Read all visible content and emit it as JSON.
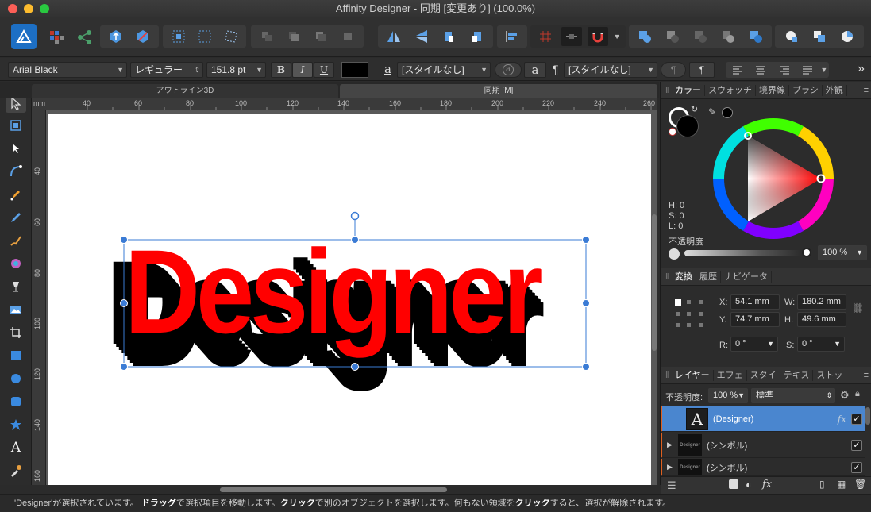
{
  "window": {
    "title": "Affinity Designer - 同期 [変更あり] (100.0%)"
  },
  "context_bar": {
    "font_family": "Arial Black",
    "font_style": "レギュラー",
    "font_size": "151.8 pt",
    "bold_label": "B",
    "italic_label": "I",
    "underline_label": "U",
    "char_style_glyph": "a",
    "char_style": "[スタイルなし]",
    "char_glyph2": "a",
    "para_glyph": "¶",
    "para_style": "[スタイルなし]",
    "para_btn_glyph": "¶",
    "more_glyph": "»"
  },
  "doc_tabs": [
    "アウトライン3D",
    "同期 [M]"
  ],
  "ruler": {
    "unit": "mm",
    "top_ticks": [
      "40",
      "60",
      "80",
      "100",
      "120",
      "140",
      "160",
      "180",
      "200",
      "220",
      "240",
      "260"
    ],
    "left_ticks": [
      "40",
      "60",
      "80",
      "100",
      "120",
      "140",
      "160"
    ]
  },
  "canvas": {
    "text": "Designer",
    "text_color": "#ff0000",
    "shadow_color": "#000000"
  },
  "color_panel": {
    "tabs": [
      "カラー",
      "スウォッチ",
      "境界線",
      "ブラシ",
      "外観"
    ],
    "h_label": "H: 0",
    "s_label": "S: 0",
    "l_label": "L: 0",
    "opacity_label": "不透明度",
    "opacity_value": "100 %"
  },
  "transform_panel": {
    "tabs": [
      "変換",
      "履歴",
      "ナビゲータ"
    ],
    "x_label": "X:",
    "x_value": "54.1 mm",
    "w_label": "W:",
    "w_value": "180.2 mm",
    "y_label": "Y:",
    "y_value": "74.7 mm",
    "h_label": "H:",
    "h_value": "49.6 mm",
    "r_label": "R:",
    "r_value": "0 °",
    "s_label": "S:",
    "s_value": "0 °"
  },
  "layers_panel": {
    "tabs": [
      "レイヤー",
      "エフェ",
      "スタイ",
      "テキス",
      "ストッ"
    ],
    "opacity_label": "不透明度:",
    "opacity_value": "100 %",
    "blend_mode": "標準",
    "layers": [
      {
        "name": "(Designer)",
        "thumb": "A",
        "selected": true,
        "fx": "fx"
      },
      {
        "name": "(シンボル)",
        "thumb": "Designer",
        "selected": false
      },
      {
        "name": "(シンボル)",
        "thumb": "Designer",
        "selected": false
      }
    ]
  },
  "status": {
    "part1": "'Designer'が選択されています。",
    "b1": "ドラッグ",
    "part2": "で選択項目を移動します。",
    "b2": "クリック",
    "part3": "で別のオブジェクトを選択します。何もない領域を",
    "b3": "クリック",
    "part4": "すると、選択が解除されます。"
  },
  "colors": {
    "accent": "#4a8fd8",
    "selected_row": "#4a86cf"
  }
}
